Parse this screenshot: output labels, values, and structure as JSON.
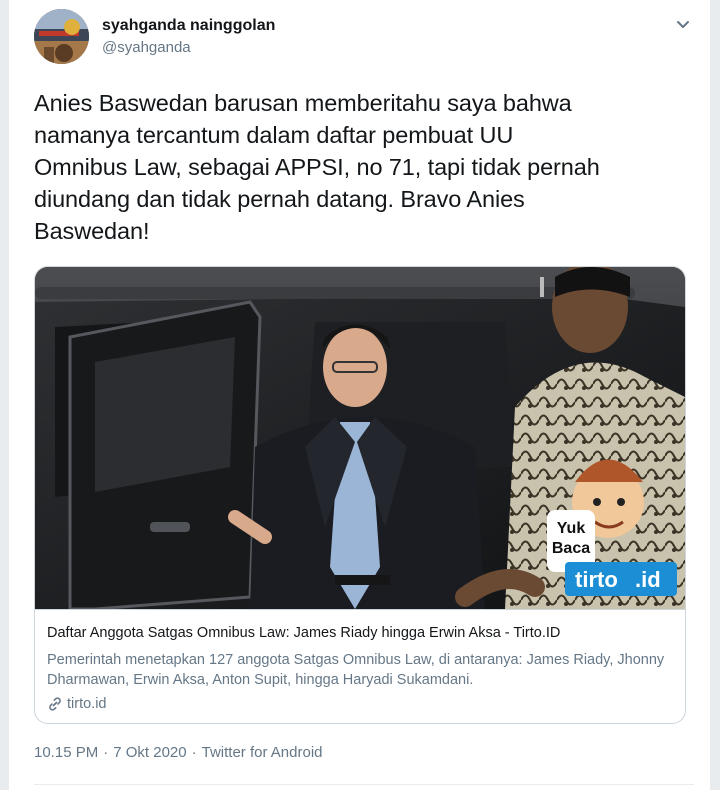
{
  "author": {
    "name": "syahganda nainggolan",
    "handle": "@syahganda"
  },
  "tweet": {
    "text": "Anies Baswedan barusan memberitahu saya bahwa\nnamanya tercantum dalam daftar pembuat UU\nOmnibus Law, sebagai APPSI, no 71, tapi tidak pernah\ndiundang dan tidak pernah datang. Bravo Anies\nBaswedan!"
  },
  "card": {
    "title": "Daftar Anggota Satgas Omnibus Law: James Riady hingga Erwin Aksa - Tirto.ID",
    "description": "Pemerintah menetapkan 127 anggota Satgas Omnibus Law, di antaranya: James Riady, Jhonny Dharmawan, Erwin Aksa, Anton Supit, hingga Haryadi Sukamdani.",
    "domain": "tirto.id",
    "badge": {
      "line1": "Yuk",
      "line2": "Baca",
      "brand": "tirto",
      "brand_suffix": ".id"
    }
  },
  "meta": {
    "time": "10.15 PM",
    "separator": "·",
    "date": "7 Okt 2020",
    "source": "Twitter for Android"
  },
  "colors": {
    "text": "#14171a",
    "secondary": "#657786",
    "border": "#ccd6dd",
    "tirto_blue": "#1b8ed6"
  },
  "icons": {
    "caret": "chevron-down-icon",
    "link": "link-icon"
  }
}
